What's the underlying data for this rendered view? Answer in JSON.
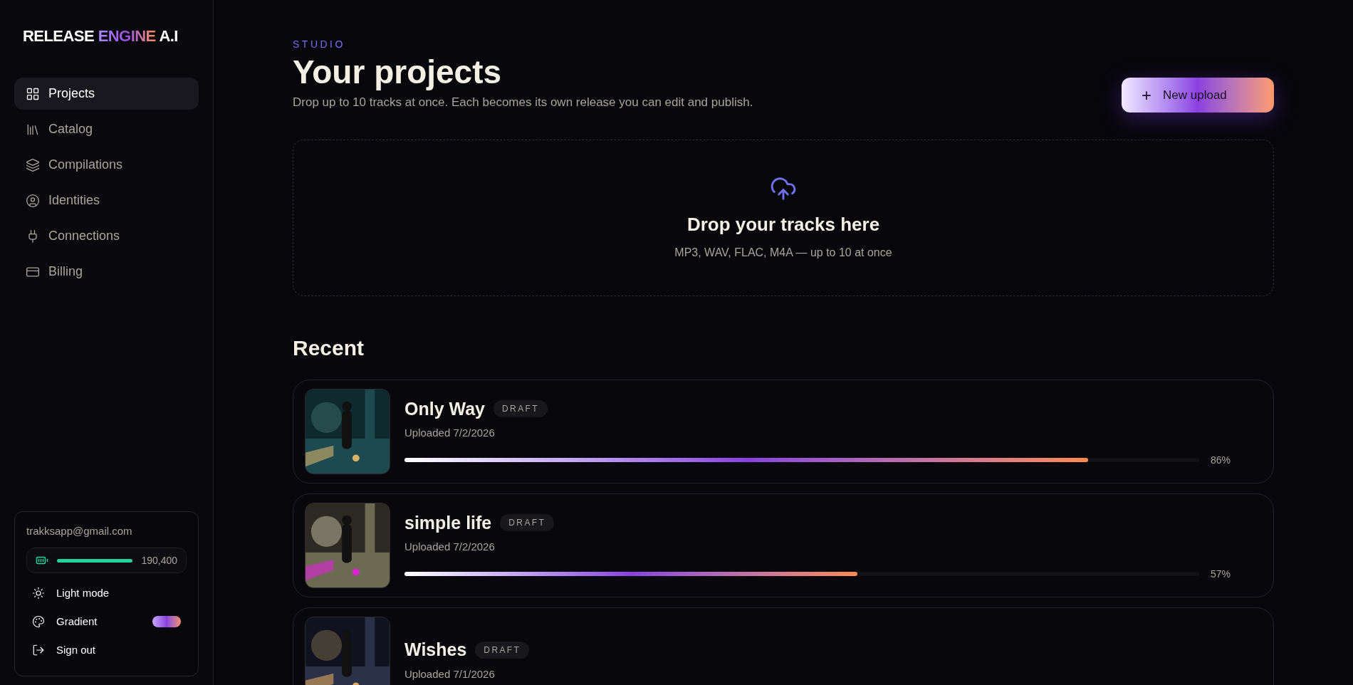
{
  "logo": {
    "parts": [
      "RELEASE ",
      "ENGINE",
      " A.I"
    ]
  },
  "sidebar": {
    "items": [
      {
        "label": "Projects",
        "selected": true
      },
      {
        "label": "Catalog",
        "selected": false
      },
      {
        "label": "Compilations",
        "selected": false
      },
      {
        "label": "Identities",
        "selected": false
      },
      {
        "label": "Connections",
        "selected": false
      },
      {
        "label": "Billing",
        "selected": false
      }
    ]
  },
  "account": {
    "email": "trakksapp@gmail.com",
    "credits": {
      "level": 1,
      "reading": "190,400"
    },
    "menu": [
      {
        "kind": "action",
        "label": "Light mode"
      },
      {
        "kind": "toggle",
        "label": "Gradient",
        "on": true
      },
      {
        "kind": "action",
        "label": "Sign out"
      }
    ]
  },
  "header": {
    "eyebrow": "STUDIO",
    "title": "Your projects",
    "subtitle": "Drop up to 10 tracks at once. Each becomes its own release you can edit and publish.",
    "button": {
      "icon": "+",
      "label": "New upload"
    }
  },
  "dropzone": {
    "title": "Drop your tracks here",
    "hint": "MP3, WAV, FLAC, M4A — up to 10 at once"
  },
  "recent": {
    "title": "Recent",
    "projects": [
      {
        "title": "Only Way",
        "status": "DRAFT",
        "date": "Uploaded 7/2/2026",
        "level": 0.86,
        "reading": "86%"
      },
      {
        "title": "simple life",
        "status": "DRAFT",
        "date": "Uploaded 7/2/2026",
        "level": 0.57,
        "reading": "57%"
      },
      {
        "title": "Wishes",
        "status": "DRAFT",
        "date": "Uploaded 7/1/2026"
      }
    ]
  }
}
